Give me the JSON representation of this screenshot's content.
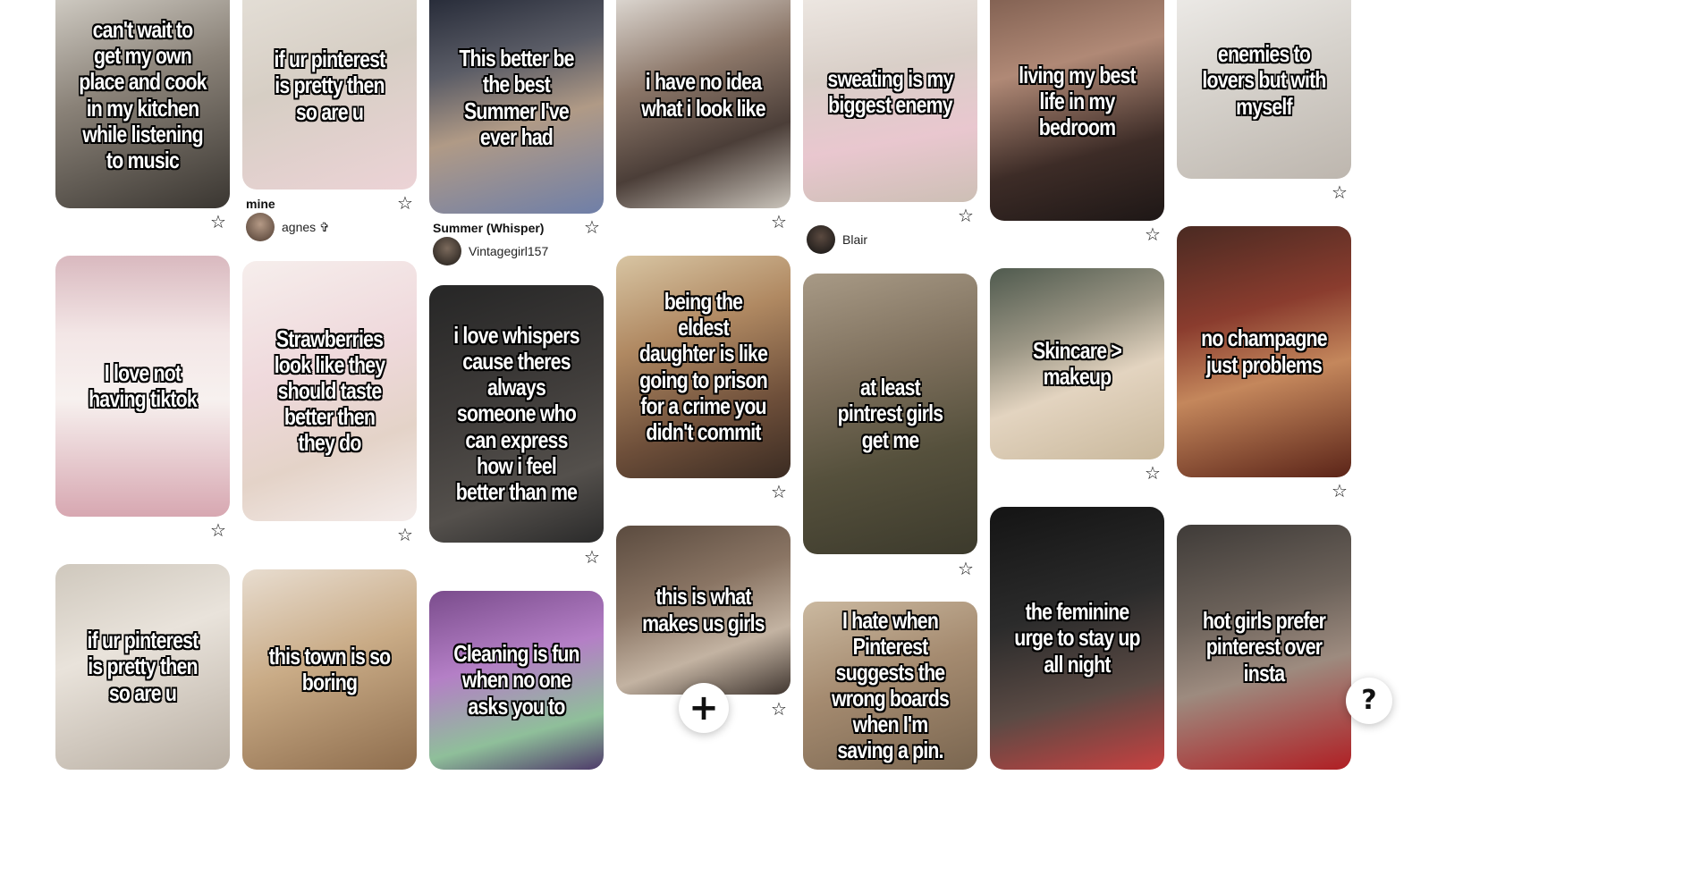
{
  "pins": [
    {
      "caption": "can't wait to get my own place and cook in my kitchen while listening to music"
    },
    {
      "caption": "I love not having tiktok"
    },
    {
      "caption": "if ur pinterest is pretty then so are u"
    },
    {
      "caption": "if ur pinterest is pretty then so are u",
      "title": "mine",
      "author": "agnes ✞"
    },
    {
      "caption": "Strawberries look like they should taste better then they do"
    },
    {
      "caption": "this town is so boring"
    },
    {
      "caption": "This better be the best Summer I've ever had",
      "title": "Summer (Whisper)",
      "author": "Vintagegirl157"
    },
    {
      "caption": "i love whispers cause theres always someone who can express how i feel better than me"
    },
    {
      "caption": "Cleaning is fun when no one asks you to"
    },
    {
      "caption": "i have no idea what i look like"
    },
    {
      "caption": "being the eldest daughter is like going to prison for a crime you didn't commit"
    },
    {
      "caption": "this is what makes us girls"
    },
    {
      "caption": "sweating is my biggest enemy",
      "author": "Blair"
    },
    {
      "caption": "at least pintrest girls get me"
    },
    {
      "caption": "I hate when Pinterest suggests the wrong boards when I'm saving a pin."
    },
    {
      "caption": "living my best life in my bedroom"
    },
    {
      "caption": "Skincare > makeup"
    },
    {
      "caption": "the feminine urge to stay up all night"
    },
    {
      "caption": "enemies to lovers but with myself"
    },
    {
      "caption": "no champagne just problems"
    },
    {
      "caption": "hot girls prefer pinterest over insta"
    }
  ],
  "icons": {
    "star": "☆",
    "plus": "+",
    "help": "?"
  }
}
